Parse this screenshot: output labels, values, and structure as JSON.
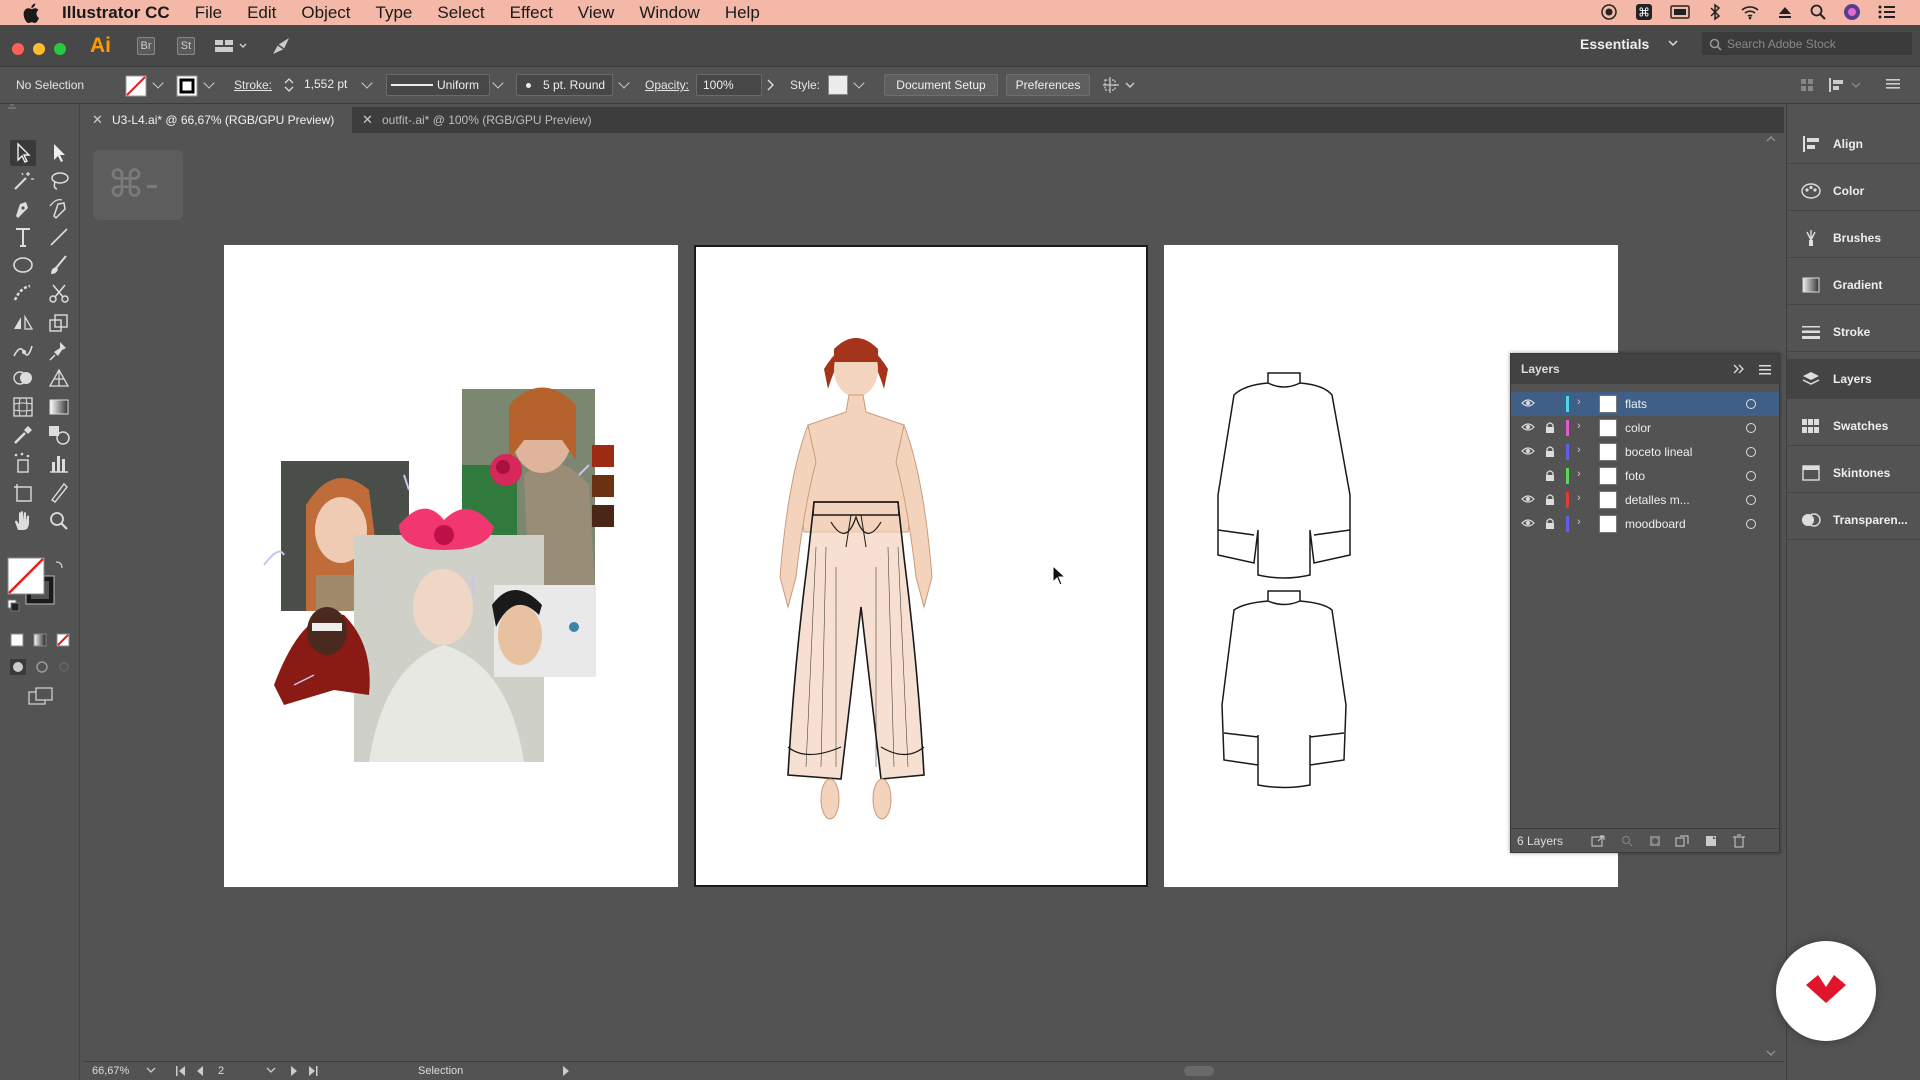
{
  "menubar": {
    "app": "Illustrator CC",
    "items": [
      "File",
      "Edit",
      "Object",
      "Type",
      "Select",
      "Effect",
      "View",
      "Window",
      "Help"
    ]
  },
  "appbar": {
    "logo": "Ai",
    "bridge": "Br",
    "stock": "St",
    "workspace": "Essentials",
    "search_placeholder": "Search Adobe Stock"
  },
  "control": {
    "selection": "No Selection",
    "stroke_label": "Stroke:",
    "stroke_value": "1,552 pt",
    "profile": "Uniform",
    "brush": "5 pt. Round",
    "opacity_label": "Opacity:",
    "opacity_value": "100%",
    "style_label": "Style:",
    "doc_setup": "Document Setup",
    "preferences": "Preferences"
  },
  "tabs": [
    {
      "label": "U3-L4.ai* @ 66,67% (RGB/GPU Preview)",
      "active": true
    },
    {
      "label": "outfit-.ai* @ 100% (RGB/GPU Preview)",
      "active": false
    }
  ],
  "dock": [
    {
      "label": "Align",
      "icon": "align-icon"
    },
    {
      "label": "Color",
      "icon": "color-icon"
    },
    {
      "label": "Brushes",
      "icon": "brushes-icon"
    },
    {
      "label": "Gradient",
      "icon": "gradient-icon"
    },
    {
      "label": "Stroke",
      "icon": "stroke-icon"
    },
    {
      "label": "Layers",
      "icon": "layers-icon"
    },
    {
      "label": "Swatches",
      "icon": "swatches-icon"
    },
    {
      "label": "Skintones",
      "icon": "skintones-icon"
    },
    {
      "label": "Transparen...",
      "icon": "transparency-icon"
    }
  ],
  "layers_panel": {
    "title": "Layers",
    "count": "6 Layers",
    "rows": [
      {
        "name": "flats",
        "color": "#4cd6f0",
        "visible": true,
        "locked": false,
        "selected": true
      },
      {
        "name": "color",
        "color": "#e05ad0",
        "visible": true,
        "locked": true,
        "selected": false
      },
      {
        "name": "boceto lineal",
        "color": "#5a63e8",
        "visible": true,
        "locked": true,
        "selected": false
      },
      {
        "name": "foto",
        "color": "#5ad65a",
        "visible": false,
        "locked": true,
        "selected": false
      },
      {
        "name": "detalles m...",
        "color": "#e03a3a",
        "visible": true,
        "locked": true,
        "selected": false
      },
      {
        "name": "moodboard",
        "color": "#5a63e8",
        "visible": true,
        "locked": true,
        "selected": false
      }
    ]
  },
  "status": {
    "zoom": "66,67%",
    "artboard": "2",
    "tool": "Selection"
  },
  "shortcut_hint": "⌘-"
}
